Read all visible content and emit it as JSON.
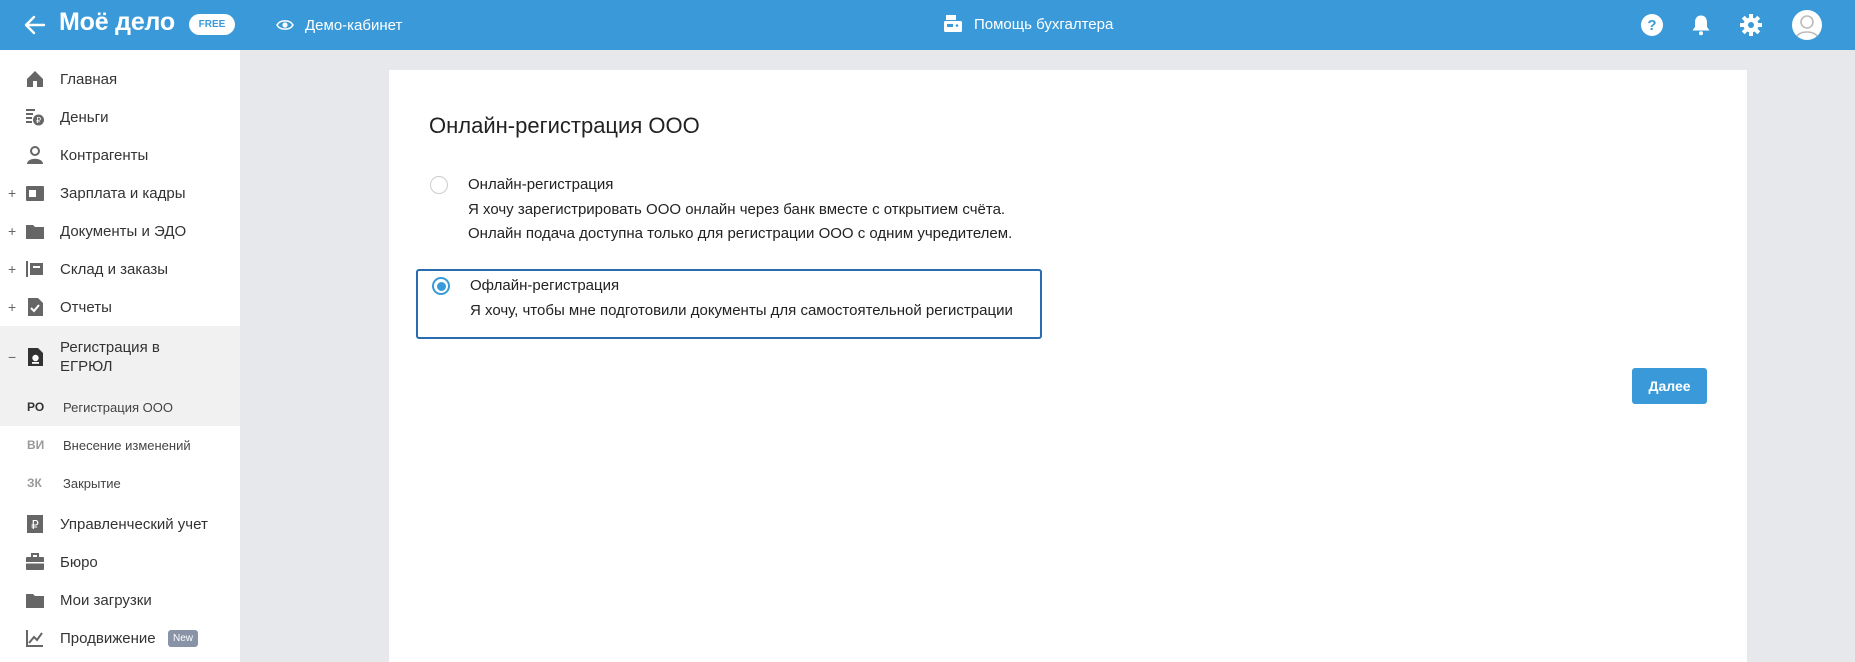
{
  "header": {
    "logo_text": "Моё дело",
    "plan_badge": "FREE",
    "demo_label": "Демо-кабинет",
    "helper_label": "Помощь бухгалтера",
    "icons": [
      "arrow-left-icon",
      "eye-icon",
      "cash-register-icon",
      "help-icon",
      "bell-icon",
      "gear-icon",
      "user-avatar-icon"
    ]
  },
  "sidebar": {
    "items": [
      {
        "label": "Главная",
        "icon": "home-icon",
        "expandable": false
      },
      {
        "label": "Деньги",
        "icon": "money-icon",
        "expandable": false
      },
      {
        "label": "Контрагенты",
        "icon": "contractors-icon",
        "expandable": false
      },
      {
        "label": "Зарплата и кадры",
        "icon": "salary-icon",
        "expandable": true
      },
      {
        "label": "Документы и ЭДО",
        "icon": "folder-icon",
        "expandable": true
      },
      {
        "label": "Склад и заказы",
        "icon": "warehouse-icon",
        "expandable": true
      },
      {
        "label": "Отчеты",
        "icon": "reports-icon",
        "expandable": true
      },
      {
        "label_line1": "Регистрация в",
        "label_line2": "ЕГРЮЛ",
        "icon": "registration-icon",
        "expandable": true,
        "expanded": true
      }
    ],
    "subitems": [
      {
        "abbr": "РО",
        "label": "Регистрация ООО",
        "current": true
      },
      {
        "abbr": "ВИ",
        "label": "Внесение изменений",
        "current": false
      },
      {
        "abbr": "ЗК",
        "label": "Закрытие",
        "current": false
      }
    ],
    "bottom_items": [
      {
        "label": "Управленческий учет",
        "icon": "ruble-doc-icon"
      },
      {
        "label": "Бюро",
        "icon": "briefcase-icon"
      },
      {
        "label": "Мои загрузки",
        "icon": "folder-icon"
      },
      {
        "label": "Продвижение",
        "icon": "chart-icon",
        "badge": "New"
      }
    ]
  },
  "main": {
    "title": "Онлайн-регистрация ООО",
    "options": [
      {
        "title": "Онлайн-регистрация",
        "desc_line1": "Я хочу зарегистрировать ООО онлайн через банк вместе с открытием счёта.",
        "desc_line2": "Онлайн подача доступна только для регистрации ООО с одним учредителем.",
        "selected": false
      },
      {
        "title": "Офлайн-регистрация",
        "desc_line1": "Я хочу, чтобы мне подготовили документы для самостоятельной регистрации",
        "selected": true
      }
    ],
    "next_button": "Далее"
  },
  "colors": {
    "primary": "#3a9ad9",
    "selected_border": "#2b6cb0",
    "background": "#e6e8ec"
  }
}
